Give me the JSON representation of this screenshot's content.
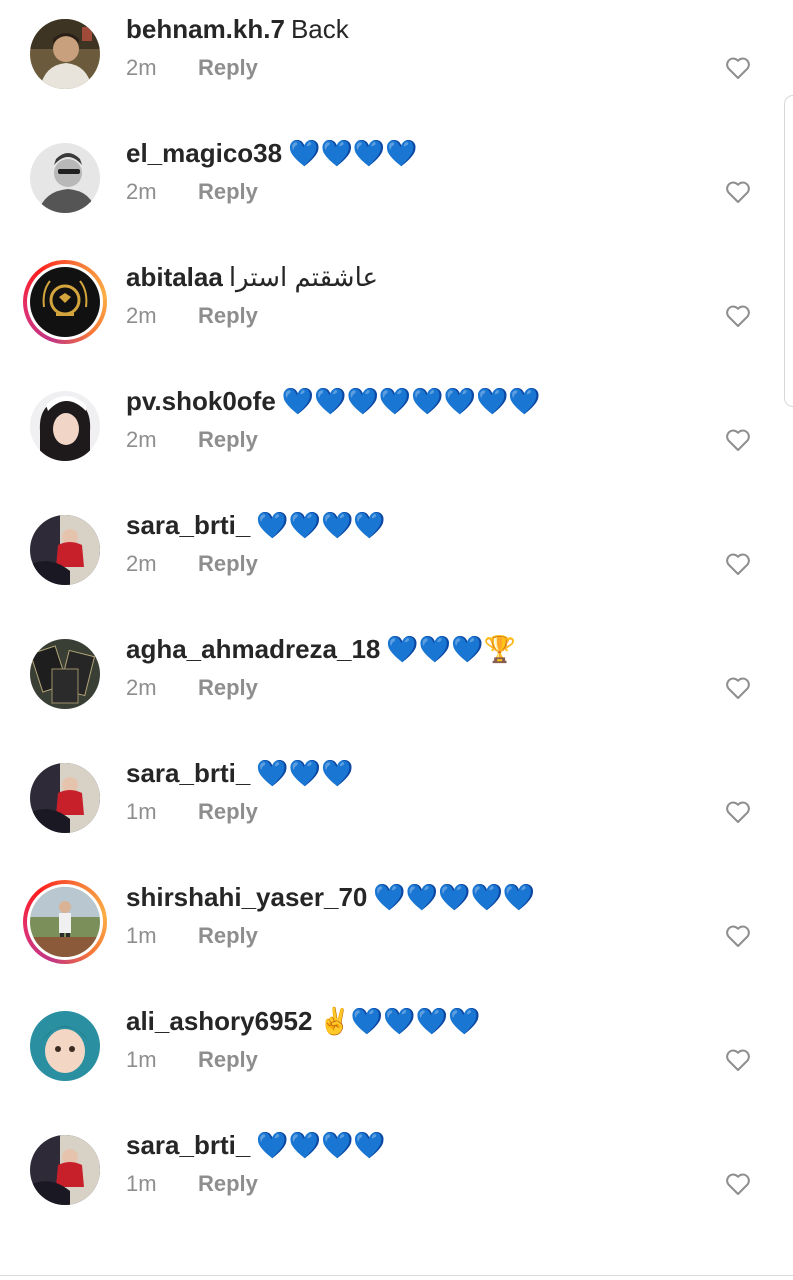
{
  "comments": [
    {
      "username": "behnam.kh.7",
      "text": "Back",
      "time": "2m",
      "reply": "Reply",
      "avatar": "avatar-behnam",
      "ring": false
    },
    {
      "username": "el_magico38",
      "text": "💙💙💙💙",
      "time": "2m",
      "reply": "Reply",
      "avatar": "avatar-elmagico",
      "ring": false
    },
    {
      "username": "abitalaa",
      "text": "عاشقتم استرا",
      "time": "2m",
      "reply": "Reply",
      "avatar": "avatar-abitalaa-logo",
      "ring": true
    },
    {
      "username": "pv.shok0ofe",
      "text": "💙💙💙💙💙💙💙💙",
      "time": "2m",
      "reply": "Reply",
      "avatar": "avatar-shokoofe",
      "ring": false
    },
    {
      "username": "sara_brti_",
      "text": "💙💙💙💙",
      "time": "2m",
      "reply": "Reply",
      "avatar": "avatar-sara",
      "ring": false
    },
    {
      "username": "agha_ahmadreza_18",
      "text": "💙💙💙🏆",
      "time": "2m",
      "reply": "Reply",
      "avatar": "avatar-ahmadreza",
      "ring": false
    },
    {
      "username": "sara_brti_",
      "text": "💙💙💙",
      "time": "1m",
      "reply": "Reply",
      "avatar": "avatar-sara",
      "ring": false
    },
    {
      "username": "shirshahi_yaser_70",
      "text": "💙💙💙💙💙",
      "time": "1m",
      "reply": "Reply",
      "avatar": "avatar-yaser",
      "ring": true
    },
    {
      "username": "ali_ashory6952",
      "text": "✌️💙💙💙💙",
      "time": "1m",
      "reply": "Reply",
      "avatar": "avatar-baby",
      "ring": false
    },
    {
      "username": "sara_brti_",
      "text": "💙💙💙💙",
      "time": "1m",
      "reply": "Reply",
      "avatar": "avatar-sara",
      "ring": false
    }
  ],
  "like_icon": "heart-outline-icon",
  "colors": {
    "username": "#262626",
    "meta": "#8e8e8e",
    "heart_outline": "#8e8e8e",
    "story_ring_start": "#c13584",
    "story_ring_end": "#fcaf45"
  }
}
